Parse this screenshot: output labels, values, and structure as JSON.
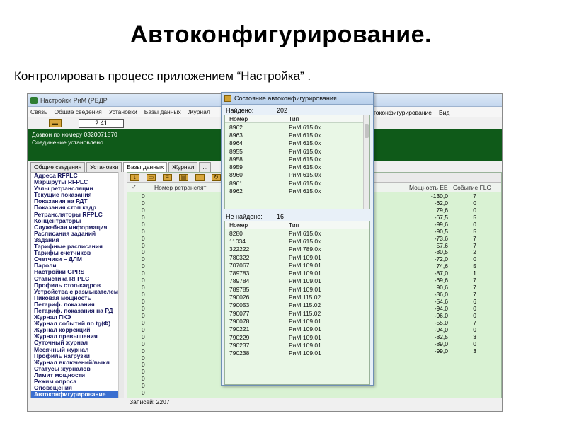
{
  "slide": {
    "title": "Автоконфигурирование.",
    "subtitle": "Контролировать процесс приложением “Настройка” ."
  },
  "app": {
    "window_title": "Настройки РиМ (РБДР",
    "menu": [
      "Связь",
      "Общие сведения",
      "Установки",
      "Базы данных",
      "Журнал"
    ],
    "menu_right": [
      "Автоконфигурирование",
      "Вид"
    ],
    "time": "2:41",
    "console_lines": [
      "Дозвон по номеру 0320071570",
      "Соединение установлено"
    ],
    "tabs": [
      "Общие сведения",
      "Установки",
      "Базы данных",
      "Журнал",
      "..."
    ],
    "left_items": [
      "Адреса RFPLC",
      "Маршруты RFPLC",
      "Узлы ретрансляции",
      "Текущие показания",
      "Показания на РДТ",
      "Показания стоп кадр",
      "Ретрансляторы RFPLC",
      "Концентраторы",
      "Служебная информация",
      "Расписания заданий",
      "Задания",
      "Тарифные расписания",
      "Тарифы счетчиков",
      "Счетчики – ДЛМ",
      "Пароли",
      "Настройки GPRS",
      "Статистика RFPLC",
      "Профиль стоп-кадров",
      "Устройства с размыкателем",
      "Пиковая мощность",
      "Петариф. показания",
      "Петариф. показания на РД",
      "Журнал ПКЭ",
      "Журнал событий по tg(Ф)",
      "Журнал коррекций",
      "Журнал превышения",
      "Суточный журнал",
      "Месячный журнал",
      "Профиль нагрузки",
      "Журнал включений/выкл",
      "Статусы журналов",
      "Лимит мощности",
      "Режим опроса",
      "Оповещения",
      "Автоконфигурирование"
    ],
    "table_headers": [
      "Номер ретранслят",
      "Мощность ЕЕ",
      "Событие FLC"
    ],
    "table_first_col": [
      "0",
      "0",
      "0",
      "0",
      "0",
      "0",
      "0",
      "0",
      "0",
      "0",
      "0",
      "0",
      "0",
      "0",
      "0",
      "0",
      "0",
      "0",
      "0",
      "0",
      "0",
      "0",
      "0",
      "0",
      "0",
      "0",
      "0",
      "0",
      "0",
      "0"
    ],
    "right_values": [
      [
        "-130,0",
        "7"
      ],
      [
        "-62,0",
        "0"
      ],
      [
        "79,6",
        "0"
      ],
      [
        "-67,5",
        "5"
      ],
      [
        "-99,6",
        "0"
      ],
      [
        "-90,5",
        "5"
      ],
      [
        "-73,6",
        "7"
      ],
      [
        "57,6",
        "7"
      ],
      [
        "-80,5",
        "2"
      ],
      [
        "-72,0",
        "0"
      ],
      [
        "74,6",
        "5"
      ],
      [
        "-87,0",
        "1"
      ],
      [
        "-69,6",
        "7"
      ],
      [
        "90,6",
        "7"
      ],
      [
        "-36,0",
        "7"
      ],
      [
        "-54,6",
        "6"
      ],
      [
        "-94,0",
        "0"
      ],
      [
        "-96,0",
        "0"
      ],
      [
        "-55,0",
        "7"
      ],
      [
        "-94,0",
        "0"
      ],
      [
        "-82,5",
        "3"
      ],
      [
        "-89,0",
        "0"
      ],
      [
        "-99,0",
        "3"
      ]
    ],
    "status": "Записей: 2207"
  },
  "dialog": {
    "title": "Состояние автоконфигурирования",
    "found_label": "Найдено:",
    "found_count": "202",
    "not_found_label": "Не найдено:",
    "not_found_count": "16",
    "col_number": "Номер",
    "col_type": "Тип",
    "found_rows": [
      [
        "8962",
        "РиМ 615.0x"
      ],
      [
        "8963",
        "РиМ 615.0x"
      ],
      [
        "8964",
        "РиМ 615.0x"
      ],
      [
        "8955",
        "РиМ 615.0x"
      ],
      [
        "8958",
        "РиМ 615.0x"
      ],
      [
        "8959",
        "РиМ 615.0x"
      ],
      [
        "8960",
        "РиМ 615.0x"
      ],
      [
        "8961",
        "РиМ 615.0x"
      ],
      [
        "8962",
        "РиМ 615.0x"
      ]
    ],
    "not_found_rows": [
      [
        "8280",
        "РиМ 615.0x"
      ],
      [
        "11034",
        "РиМ 615.0x"
      ],
      [
        "322222",
        "РиМ 789.0x"
      ],
      [
        "780322",
        "РиМ 109.01"
      ],
      [
        "707067",
        "РиМ 109.01"
      ],
      [
        "789783",
        "РиМ 109.01"
      ],
      [
        "789784",
        "РиМ 109.01"
      ],
      [
        "789785",
        "РиМ 109.01"
      ],
      [
        "790026",
        "РиМ 115.02"
      ],
      [
        "790053",
        "РиМ 115.02"
      ],
      [
        "790077",
        "РиМ 115.02"
      ],
      [
        "790078",
        "РиМ 109.01"
      ],
      [
        "790221",
        "РиМ 109.01"
      ],
      [
        "790229",
        "РиМ 109.01"
      ],
      [
        "790237",
        "РиМ 109.01"
      ],
      [
        "790238",
        "РиМ 109.01"
      ]
    ]
  }
}
